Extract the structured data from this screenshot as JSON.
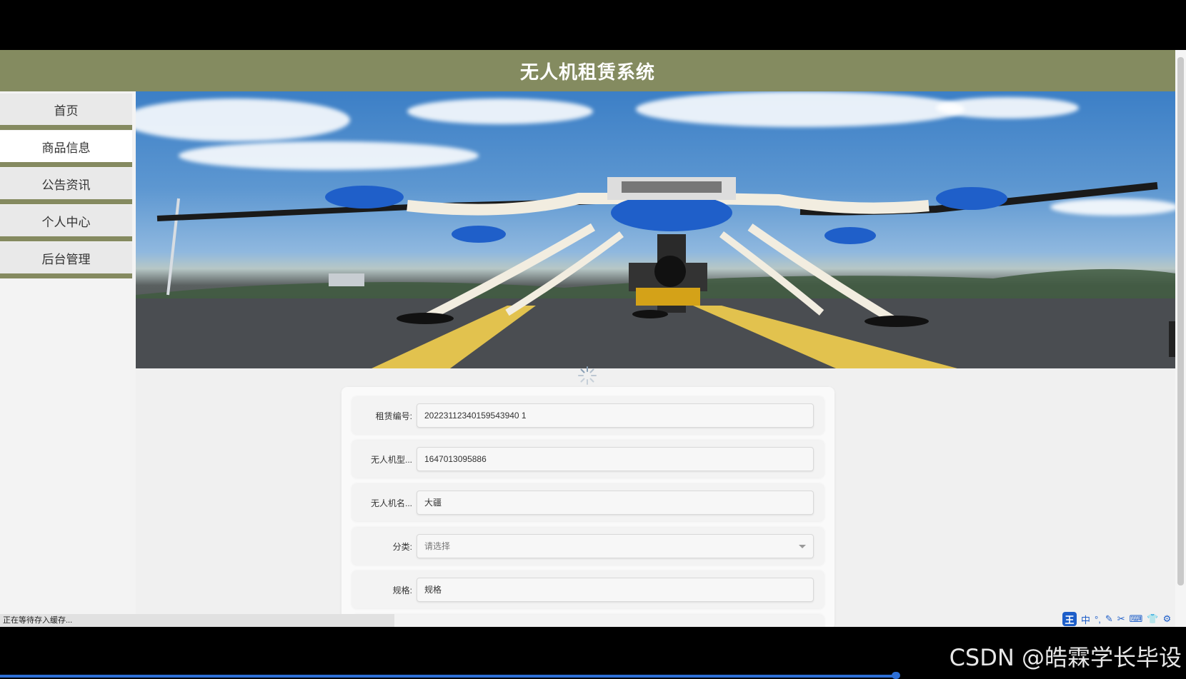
{
  "app": {
    "title": "无人机租赁系统"
  },
  "sidebar": {
    "items": [
      {
        "label": "首页"
      },
      {
        "label": "商品信息",
        "active": true
      },
      {
        "label": "公告资讯"
      },
      {
        "label": "个人中心"
      },
      {
        "label": "后台管理"
      }
    ]
  },
  "carousel": {
    "slides": 3,
    "active_index": 0
  },
  "form": {
    "rental_no": {
      "label": "租赁编号:",
      "value": "20223112340159543940 1"
    },
    "model": {
      "label": "无人机型...",
      "value": "1647013095886"
    },
    "name": {
      "label": "无人机名...",
      "value": "大疆"
    },
    "category": {
      "label": "分类:",
      "placeholder": "请选择"
    },
    "spec": {
      "label": "规格:",
      "value": "规格"
    }
  },
  "status_bar": {
    "text": "正在等待存入缓存..."
  },
  "ime": {
    "badge": "王",
    "mode": "中"
  },
  "watermark": {
    "text": "CSDN @皓霖学长毕设"
  },
  "colors": {
    "header": "#848b60",
    "accent": "#858a60"
  }
}
